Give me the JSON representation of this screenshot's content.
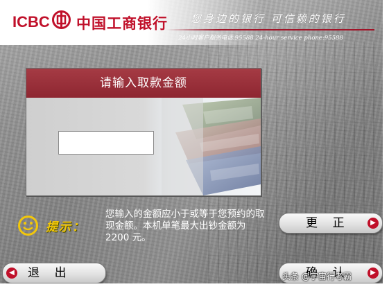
{
  "header": {
    "logo_en": "ICBC",
    "logo_cn": "中国工商银行",
    "slogan": "您身边的银行 可信赖的银行",
    "hotline": "24小时客户服务电话:95588 24-hour service phone:95588"
  },
  "panel": {
    "title": "请输入取款金额",
    "amount_value": "",
    "amount_placeholder": ""
  },
  "tip": {
    "label": "提示：",
    "text": "您输入的金额应小于或等于您预约的取现金额。本机单笔最大出钞金额为 2200 元。"
  },
  "buttons": {
    "correct": "更    正",
    "exit": "退    出",
    "confirm": "确    认"
  },
  "watermark": "头条 @宇宙行考霸",
  "colors": {
    "brand_red": "#c0102a",
    "panel_title_bg": "#8e2631",
    "tip_yellow": "#f2c70a"
  },
  "icons": {
    "logo": "icbc-emblem-icon",
    "smiley": "smiley-icon",
    "arrow_right": "arrow-right-icon",
    "arrow_left": "arrow-left-icon"
  }
}
